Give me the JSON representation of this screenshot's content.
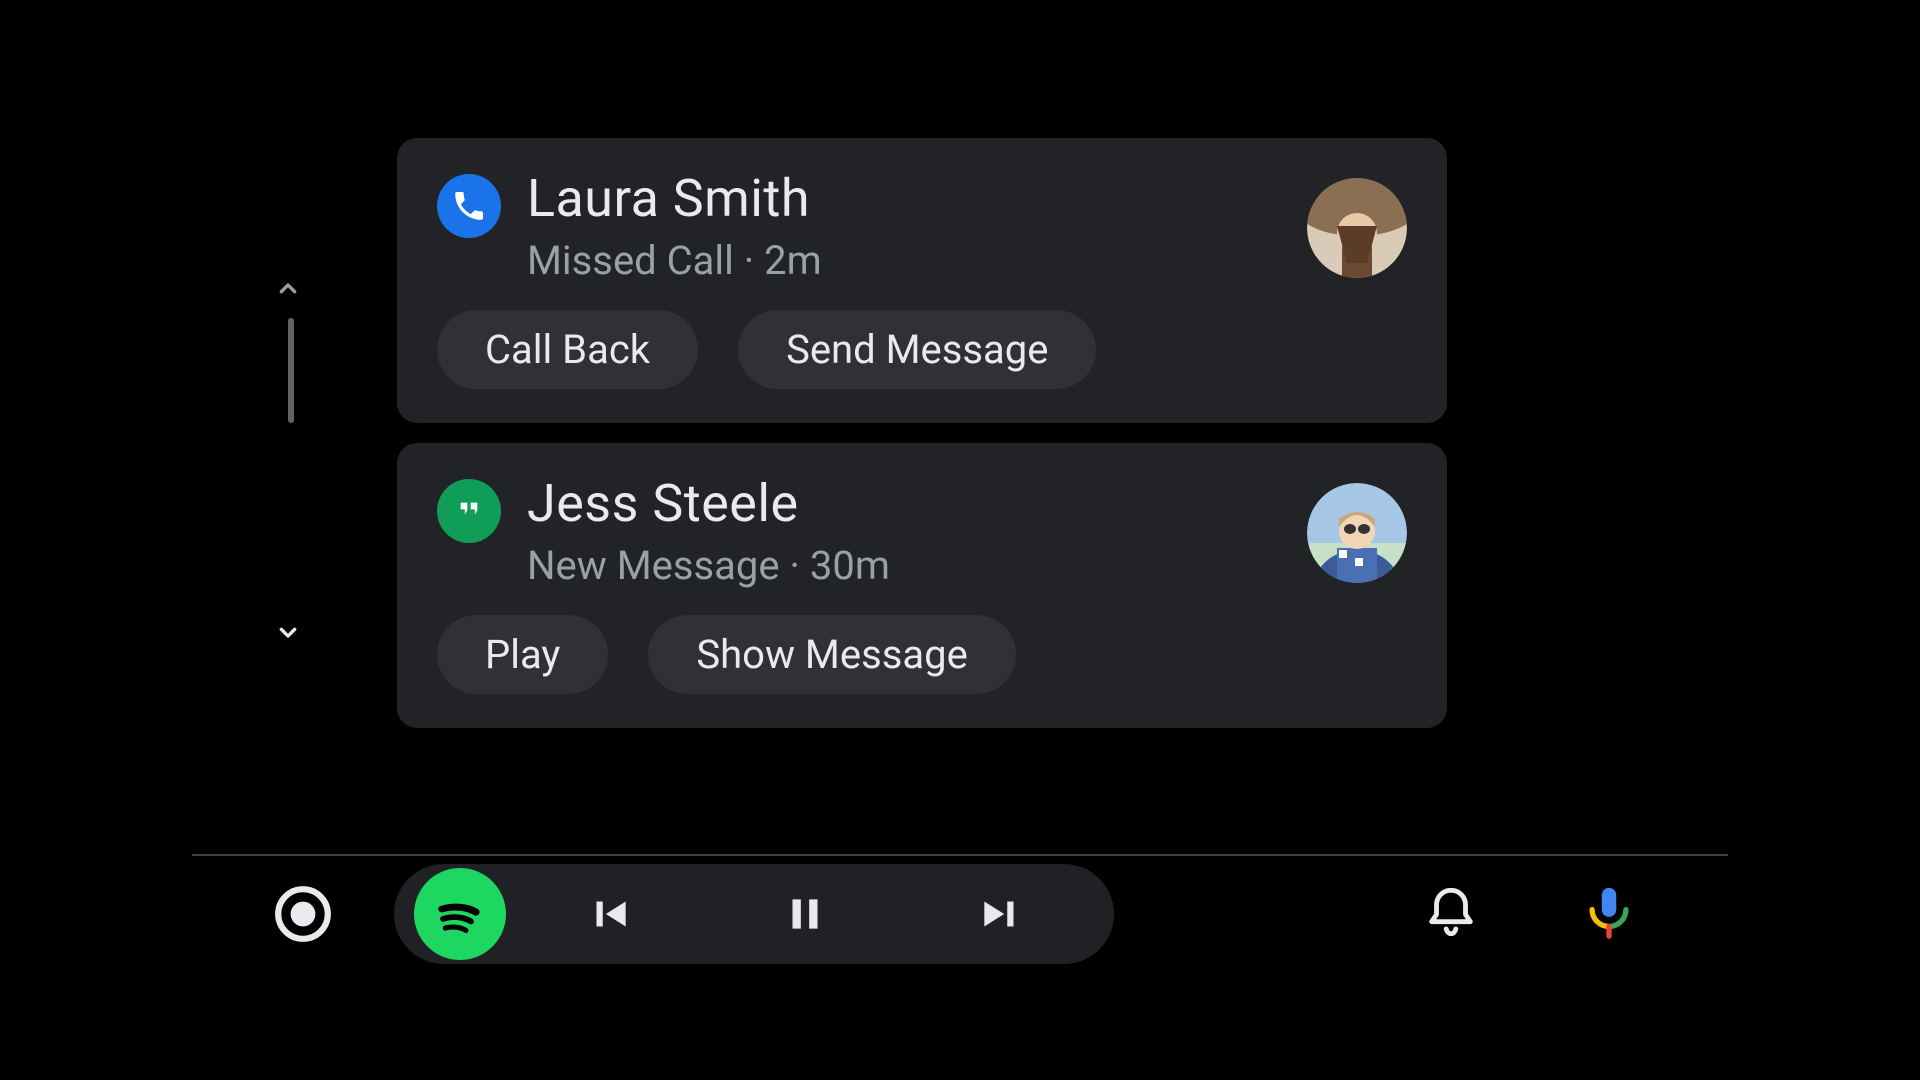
{
  "notifications": [
    {
      "app": "phone",
      "title": "Laura Smith",
      "subtitle": "Missed Call · 2m",
      "actions": {
        "primary": "Call Back",
        "secondary": "Send Message"
      }
    },
    {
      "app": "hangouts",
      "title": "Jess Steele",
      "subtitle": "New Message · 30m",
      "actions": {
        "primary": "Play",
        "secondary": "Show Message"
      }
    }
  ],
  "bottombar": {
    "media_app": "spotify"
  }
}
